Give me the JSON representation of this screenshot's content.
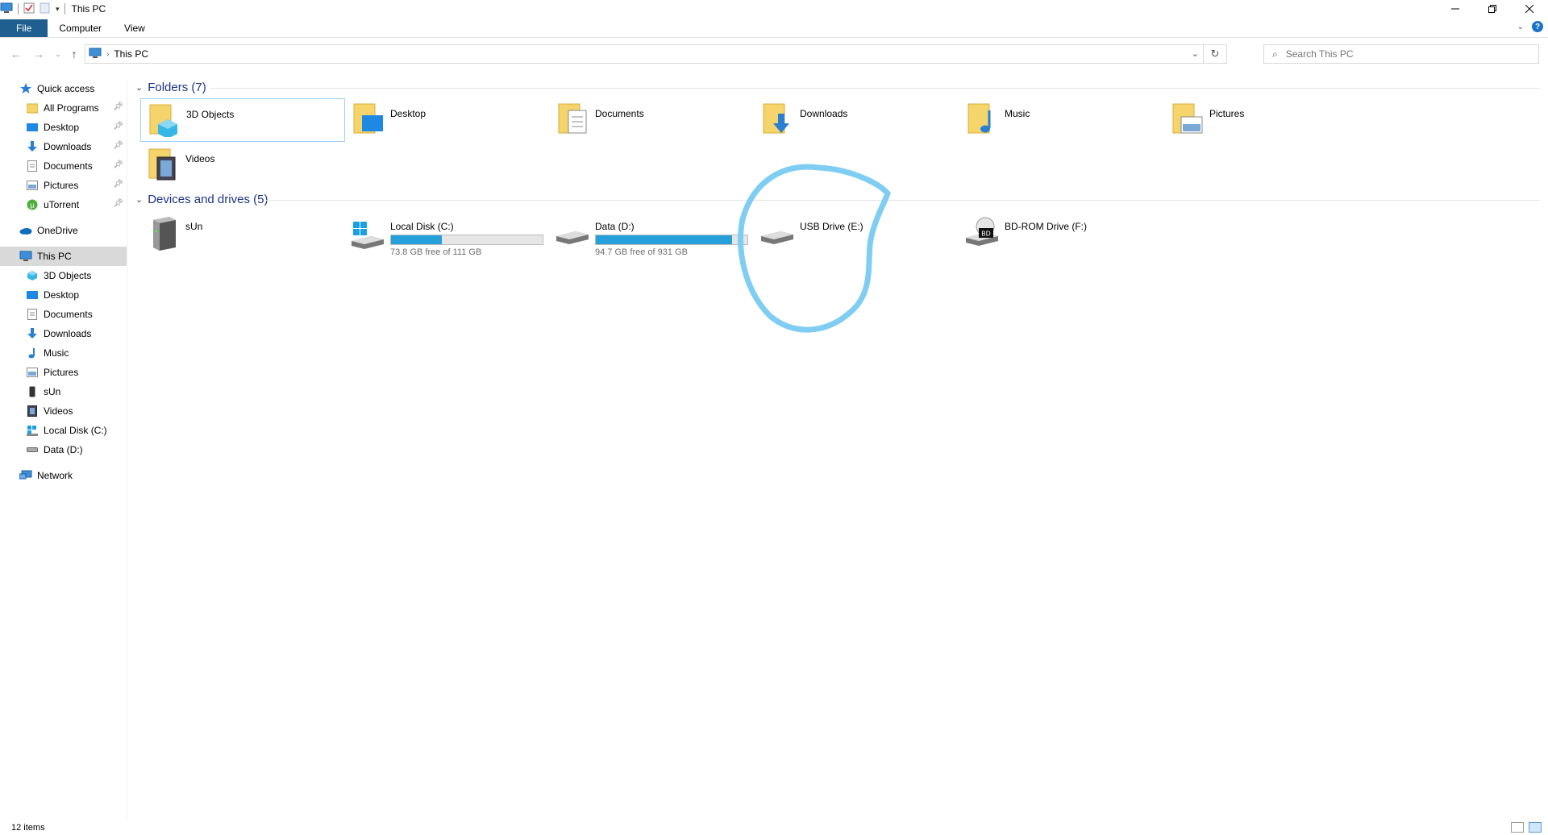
{
  "window": {
    "title": "This PC"
  },
  "ribbon": {
    "tabs": [
      "File",
      "Computer",
      "View"
    ],
    "help": "?"
  },
  "address": {
    "path_label": "This PC",
    "search_placeholder": "Search This PC"
  },
  "nav": {
    "quick_access": "Quick access",
    "quick_items": [
      "All Programs",
      "Desktop",
      "Downloads",
      "Documents",
      "Pictures",
      "uTorrent"
    ],
    "onedrive": "OneDrive",
    "this_pc": "This PC",
    "pc_items": [
      "3D Objects",
      "Desktop",
      "Documents",
      "Downloads",
      "Music",
      "Pictures",
      "sUn",
      "Videos",
      "Local Disk (C:)",
      "Data (D:)"
    ],
    "network": "Network"
  },
  "folders": {
    "header": "Folders (7)",
    "items": [
      "3D Objects",
      "Desktop",
      "Documents",
      "Downloads",
      "Music",
      "Pictures",
      "Videos"
    ]
  },
  "drives": {
    "header": "Devices and drives (5)",
    "items": [
      {
        "name": "sUn"
      },
      {
        "name": "Local Disk (C:)",
        "free": "73.8 GB free of 111 GB",
        "used_fraction": 0.335
      },
      {
        "name": "Data (D:)",
        "free": "94.7 GB free of 931 GB",
        "used_fraction": 0.898
      },
      {
        "name": "USB Drive (E:)"
      },
      {
        "name": "BD-ROM Drive (F:)",
        "badge": "BD"
      }
    ]
  },
  "status": {
    "count": "12 items"
  },
  "colors": {
    "accent": "#26a0da",
    "group_header": "#1e3287",
    "annotation": "#7fcdf2"
  }
}
